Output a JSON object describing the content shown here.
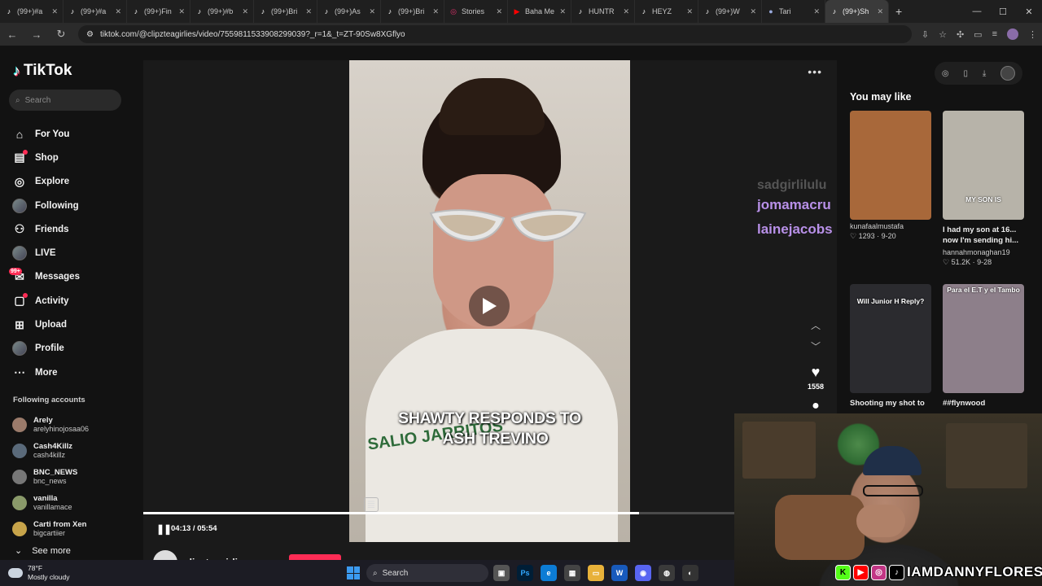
{
  "browser": {
    "tabs": [
      {
        "title": "(99+)#a",
        "icon": "tiktok-icon"
      },
      {
        "title": "(99+)#a",
        "icon": "tiktok-icon"
      },
      {
        "title": "(99+)Fin",
        "icon": "tiktok-icon"
      },
      {
        "title": "(99+)#b",
        "icon": "tiktok-icon"
      },
      {
        "title": "(99+)Bri",
        "icon": "tiktok-icon"
      },
      {
        "title": "(99+)As",
        "icon": "tiktok-icon"
      },
      {
        "title": "(99+)Bri",
        "icon": "tiktok-icon"
      },
      {
        "title": "Stories",
        "icon": "instagram-icon"
      },
      {
        "title": "Baha Me",
        "icon": "youtube-icon"
      },
      {
        "title": "HUNTR",
        "icon": "tiktok-icon"
      },
      {
        "title": "HEYZ",
        "icon": "tiktok-icon"
      },
      {
        "title": "(99+)W",
        "icon": "tiktok-icon"
      },
      {
        "title": "Tari",
        "icon": "generic-icon"
      },
      {
        "title": "(99+)Sh",
        "icon": "tiktok-icon"
      }
    ],
    "url": "tiktok.com/@clipzteagirlies/video/7559811533908299039?_r=1&_t=ZT-90Sw8XGflyo"
  },
  "tiktok": {
    "logo": "TikTok",
    "search_placeholder": "Search",
    "nav": [
      {
        "label": "For You",
        "icon": "home-icon"
      },
      {
        "label": "Shop",
        "icon": "shop-icon"
      },
      {
        "label": "Explore",
        "icon": "compass-icon"
      },
      {
        "label": "Following",
        "icon": "following-avatar"
      },
      {
        "label": "Friends",
        "icon": "friends-icon"
      },
      {
        "label": "LIVE",
        "icon": "live-avatar"
      },
      {
        "label": "Messages",
        "icon": "messages-icon",
        "badge": "99+"
      },
      {
        "label": "Activity",
        "icon": "activity-icon"
      },
      {
        "label": "Upload",
        "icon": "upload-icon"
      },
      {
        "label": "Profile",
        "icon": "profile-avatar"
      },
      {
        "label": "More",
        "icon": "more-icon"
      }
    ],
    "following_title": "Following accounts",
    "following": [
      {
        "name": "Arely",
        "handle": "arelyhinojosaa06"
      },
      {
        "name": "Cash4Killz",
        "handle": "cash4killz"
      },
      {
        "name": "BNC_NEWS",
        "handle": "bnc_news"
      },
      {
        "name": "vanilla",
        "handle": "vanillamace"
      },
      {
        "name": "Carti from Xen",
        "handle": "bigcartiier"
      }
    ],
    "see_more": "See more"
  },
  "video": {
    "caption_line1": "SHAWTY RESPONDS TO",
    "caption_line2": "ASH TREVINO",
    "shirt_text": "SALIO JARRITOS",
    "time": "04:13 / 05:54",
    "progress": 0.834,
    "likes": "1558",
    "author": "clipzteagirlies",
    "chat_ghost": "sadgirlilulu",
    "chat_users": [
      "jomamacru",
      "lainejacobs"
    ],
    "emojis": "😂 😂 😂"
  },
  "you_may_like": {
    "title": "You may like",
    "cards": [
      {
        "title": "",
        "user": "kunafaalmustafa",
        "likes": "1293",
        "date": "9-20",
        "overlay": "",
        "thumb_color": "#a8683a"
      },
      {
        "title": "I had my son at 16... now I'm sending hi...",
        "user": "hannahmonaghan19",
        "likes": "51.2K",
        "date": "9-28",
        "overlay": "MY SON IS",
        "thumb_color": "#b7b3a9"
      },
      {
        "title": "Shooting my shot to",
        "user": "",
        "likes": "",
        "date": "",
        "overlay": "Will Junior H Reply?",
        "thumb_color": "#2b2b2f"
      },
      {
        "title": "##flynwood",
        "user": "",
        "likes": "",
        "date": "",
        "overlay": "Para el E.T y el Tambo",
        "thumb_color": "#8d7f8a"
      }
    ]
  },
  "stream": {
    "handle": "IAMDANNYFLORES"
  },
  "taskbar": {
    "temp": "78°F",
    "weather": "Mostly cloudy",
    "search": "Search"
  }
}
